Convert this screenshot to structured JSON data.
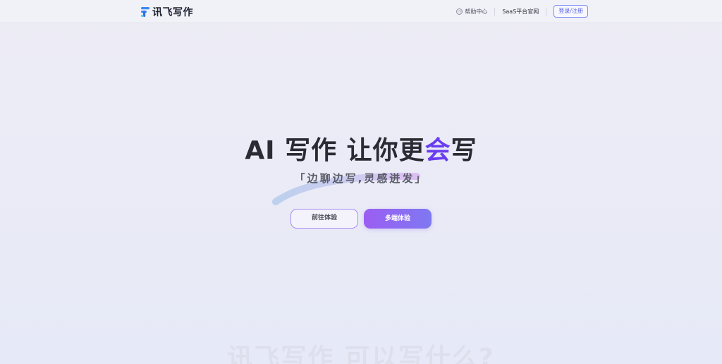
{
  "header": {
    "logo_text": "讯飞写作",
    "help_label": "帮助中心",
    "saas_label": "SaaS平台官网",
    "login_label": "登录/注册"
  },
  "hero": {
    "title_prefix": "AI 写作 让你更",
    "title_accent": "会",
    "title_suffix": "写",
    "subtitle": "「边聊边写,灵感迸发」",
    "primary_button": "前往体验",
    "secondary_button": "多端体验"
  },
  "section": {
    "heading": "讯飞写作 可以写什么?"
  },
  "colors": {
    "accent": "#6a3cf0",
    "button_gradient_start": "#9b5ef2",
    "button_gradient_end": "#7f78f2",
    "login_border": "#7d8cf0"
  }
}
